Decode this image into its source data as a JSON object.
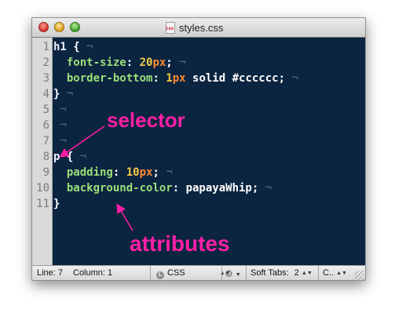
{
  "window": {
    "title": "styles.css",
    "file_icon_label": "css"
  },
  "editor": {
    "line_numbers": [
      "1",
      "2",
      "3",
      "4",
      "5",
      "6",
      "7",
      "8",
      "9",
      "10",
      "11"
    ],
    "lines": [
      [
        {
          "t": "h1",
          "c": "sel"
        },
        {
          "t": " {",
          "c": "val"
        },
        {
          "t": " ¬",
          "c": "inv"
        }
      ],
      [
        {
          "t": "  ",
          "c": "val"
        },
        {
          "t": "font-size",
          "c": "prop"
        },
        {
          "t": ": ",
          "c": "val"
        },
        {
          "t": "20",
          "c": "num-t"
        },
        {
          "t": "px",
          "c": "unit"
        },
        {
          "t": ";",
          "c": "val"
        },
        {
          "t": " ¬",
          "c": "inv"
        }
      ],
      [
        {
          "t": "  ",
          "c": "val"
        },
        {
          "t": "border-bottom",
          "c": "prop"
        },
        {
          "t": ": ",
          "c": "val"
        },
        {
          "t": "1",
          "c": "num-t"
        },
        {
          "t": "px",
          "c": "unit"
        },
        {
          "t": " solid #cccccc;",
          "c": "val"
        },
        {
          "t": " ¬",
          "c": "inv"
        }
      ],
      [
        {
          "t": "}",
          "c": "val"
        },
        {
          "t": " ¬",
          "c": "inv"
        }
      ],
      [
        {
          "t": " ¬",
          "c": "inv"
        }
      ],
      [
        {
          "t": " ¬",
          "c": "inv"
        }
      ],
      [
        {
          "t": " ¬",
          "c": "inv"
        }
      ],
      [
        {
          "t": "p",
          "c": "sel"
        },
        {
          "t": " {",
          "c": "val"
        },
        {
          "t": " ¬",
          "c": "inv"
        }
      ],
      [
        {
          "t": "  ",
          "c": "val"
        },
        {
          "t": "padding",
          "c": "prop"
        },
        {
          "t": ": ",
          "c": "val"
        },
        {
          "t": "10",
          "c": "num-t"
        },
        {
          "t": "px",
          "c": "unit"
        },
        {
          "t": ";",
          "c": "val"
        },
        {
          "t": " ¬",
          "c": "inv"
        }
      ],
      [
        {
          "t": "  ",
          "c": "val"
        },
        {
          "t": "background-color",
          "c": "prop"
        },
        {
          "t": ": papayaWhip;",
          "c": "val"
        },
        {
          "t": " ¬",
          "c": "inv"
        }
      ],
      [
        {
          "t": "}",
          "c": "val"
        }
      ]
    ]
  },
  "statusbar": {
    "line_label": "Line:",
    "line_value": "7",
    "column_label": "Column:",
    "column_value": "1",
    "language": "CSS",
    "soft_tabs_label": "Soft Tabs:",
    "soft_tabs_value": "2",
    "last_item": "C.."
  },
  "annotations": {
    "selector": "selector",
    "attributes": "attributes"
  },
  "colors": {
    "accent_annotation": "#ff1fa6",
    "editor_background": "#0b2440"
  }
}
